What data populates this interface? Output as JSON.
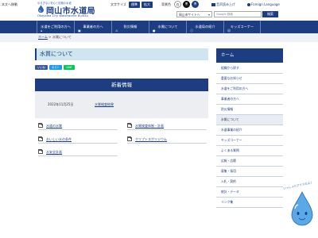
{
  "header": {
    "skip_link": "本文へ移動",
    "logo": {
      "tagline": "ゆるぎない安心と信頼の水道",
      "name": "岡山市水道局",
      "name_en": "Okayama City Waterworks Bureau"
    },
    "font_size_label": "文字サイズ",
    "font_size_buttons": [
      "標準",
      "拡大"
    ],
    "bg_color_label": "背景色",
    "bg_color_buttons": [
      {
        "label": "白",
        "bg": "#ffffff",
        "fg": "#222222"
      },
      {
        "label": "黒",
        "bg": "#111111",
        "fg": "#ffffff"
      },
      {
        "label": "青",
        "bg": "#1d3d83",
        "fg": "#ffffff"
      }
    ],
    "links": [
      "音声読み上げ",
      "Foreign Language"
    ],
    "site_select": "岡山市サイトへ",
    "search_placeholder": "Google 検索",
    "search_button": "検索"
  },
  "nav": {
    "items": [
      {
        "label": "水道をご利用の方へ",
        "icon": "home-icon"
      },
      {
        "label": "事業者の方へ",
        "icon": "building-icon"
      },
      {
        "label": "防災情報",
        "icon": "alert-icon"
      },
      {
        "label": "水質について",
        "icon": "drop-icon"
      },
      {
        "label": "水道局の紹介",
        "icon": "info-icon"
      },
      {
        "label": "キッズコーナー",
        "icon": "kids-icon"
      }
    ]
  },
  "breadcrumb": {
    "home": "ホーム",
    "separator": ">",
    "current": "水質について"
  },
  "main": {
    "title": "水質について",
    "share_buttons": [
      {
        "label": "いいね",
        "color": "#3b5998"
      },
      {
        "label": "ポスト",
        "color": "#1d9bf0"
      },
      {
        "label": "LINE",
        "color": "#06c755"
      }
    ],
    "news": {
      "heading": "新着情報",
      "items": [
        {
          "date": "2022年11月25日",
          "title": "水質検査結果"
        }
      ]
    },
    "links": [
      {
        "label": "水道の水質"
      },
      {
        "label": "水質検査体制・計画"
      },
      {
        "label": "おいしい水の条件"
      },
      {
        "label": "クリプトスポリジウム"
      },
      {
        "label": "水安全計画"
      }
    ]
  },
  "sidebar": {
    "heading": "ホーム",
    "items": [
      {
        "label": "組織から探す",
        "active": false
      },
      {
        "label": "重要なお知らせ",
        "active": false
      },
      {
        "label": "水道をご利用の方へ",
        "active": false
      },
      {
        "label": "事業者の方へ",
        "active": false
      },
      {
        "label": "防災情報",
        "active": false
      },
      {
        "label": "水質について",
        "active": true
      },
      {
        "label": "水道事業の紹介",
        "active": false
      },
      {
        "label": "キッズコーナー",
        "active": false
      },
      {
        "label": "よくある質問",
        "active": false
      },
      {
        "label": "広報・広聴",
        "active": false
      },
      {
        "label": "募集・採用",
        "active": false
      },
      {
        "label": "入札・契約",
        "active": false
      },
      {
        "label": "統計・データ",
        "active": false
      },
      {
        "label": "リンク集",
        "active": false
      }
    ]
  },
  "mascot": {
    "speech": "いっしょにアイスだよ♪",
    "colors": {
      "body": "#5aa9e6",
      "outline": "#2a67b0"
    }
  },
  "colors": {
    "primary": "#1d3d83",
    "title_bg": "#cfe5ef",
    "news_bg": "#eceef2",
    "breadcrumb_bg": "#eef1f6"
  }
}
